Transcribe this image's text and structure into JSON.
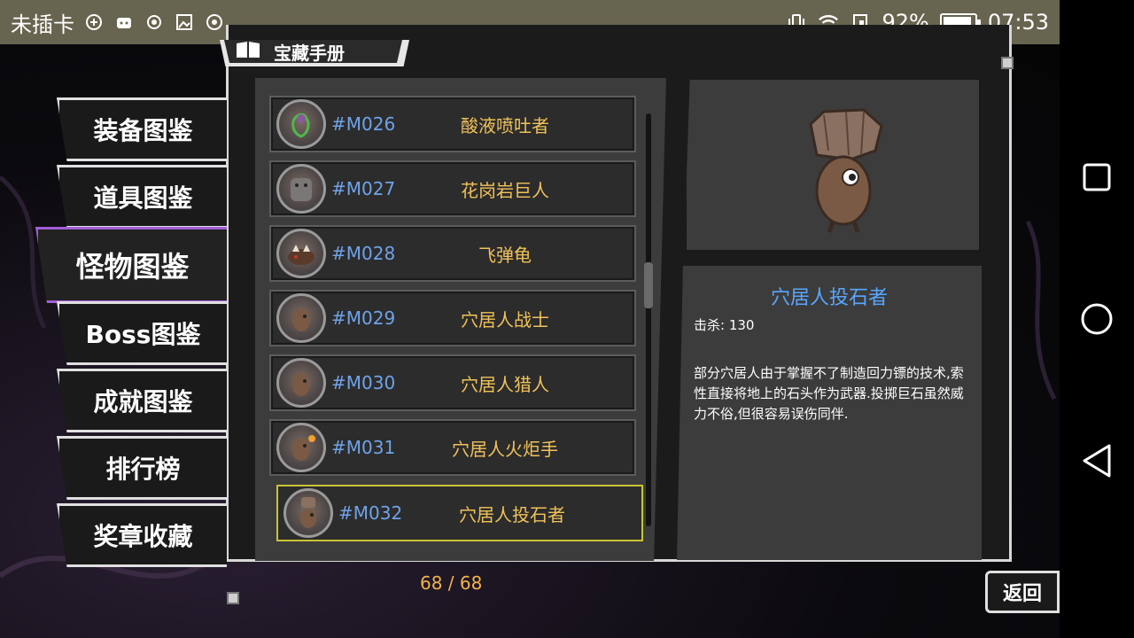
{
  "status_bar": {
    "carrier": "未插卡",
    "battery_percent": "92%",
    "battery_level": 0.92,
    "time": "07:53"
  },
  "header": {
    "title": "宝藏手册",
    "icon": "book-icon"
  },
  "sidebar": {
    "tabs": [
      {
        "label": "装备图鉴",
        "active": false
      },
      {
        "label": "道具图鉴",
        "active": false
      },
      {
        "label": "怪物图鉴",
        "active": true
      },
      {
        "label": "Boss图鉴",
        "active": false
      },
      {
        "label": "成就图鉴",
        "active": false
      },
      {
        "label": "排行榜",
        "active": false
      },
      {
        "label": "奖章收藏",
        "active": false
      }
    ]
  },
  "monster_list": {
    "items": [
      {
        "code": "#M026",
        "name": "酸液喷吐者"
      },
      {
        "code": "#M027",
        "name": "花岗岩巨人"
      },
      {
        "code": "#M028",
        "name": "飞弹龟"
      },
      {
        "code": "#M029",
        "name": "穴居人战士"
      },
      {
        "code": "#M030",
        "name": "穴居人猎人"
      },
      {
        "code": "#M031",
        "name": "穴居人火炬手"
      },
      {
        "code": "#M032",
        "name": "穴居人投石者"
      }
    ],
    "selected_index": 6
  },
  "detail": {
    "name": "穴居人投石者",
    "kills": "击杀: 130",
    "description": "部分穴居人由于掌握不了制造回力镖的技术,索性直接将地上的石头作为武器.投掷巨石虽然威力不俗,但很容易误伤同伴."
  },
  "counter": "68 / 68",
  "back_button": "返回",
  "colors": {
    "accent_purple": "#a15ed8",
    "selected_yellow": "#c9c433",
    "code_blue": "#6fa3e8",
    "name_gold": "#f1c25a",
    "title_blue": "#58a6ff"
  }
}
